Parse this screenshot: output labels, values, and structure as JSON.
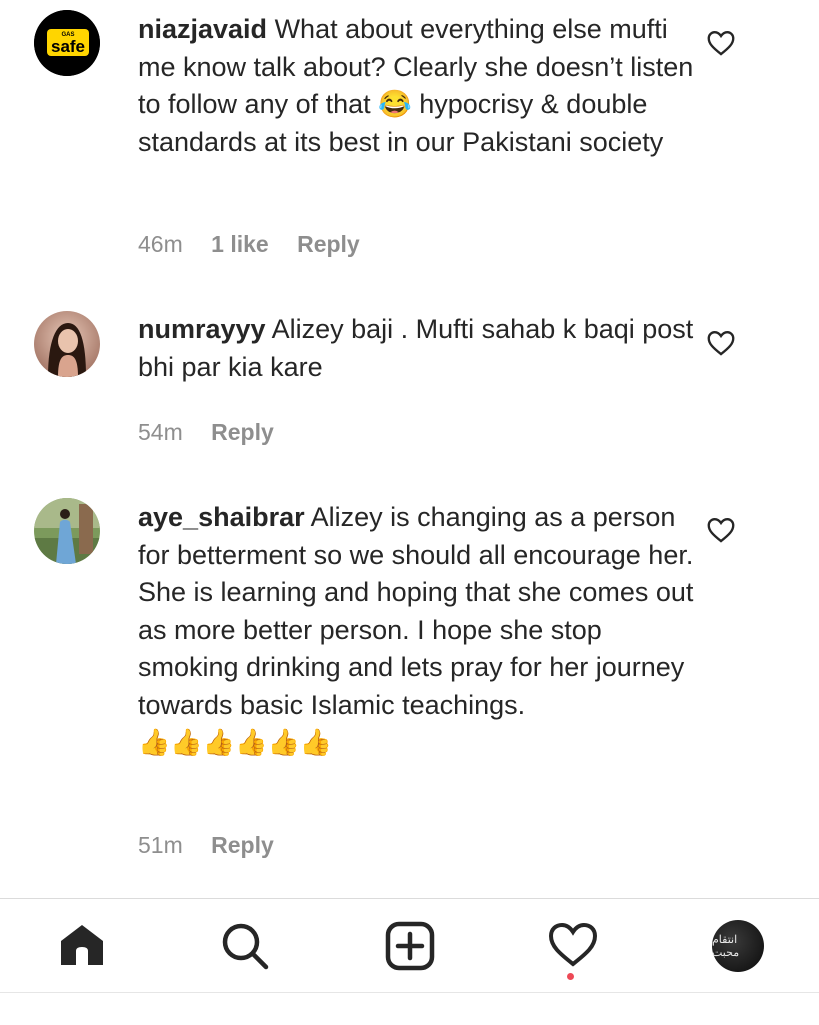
{
  "comments": [
    {
      "username": "niazjavaid",
      "text": "What about everything else mufti me know talk about? Clearly she doesn’t listen to follow any of that 😂 hypocrisy & double standards at its best in our Pakistani society",
      "time": "46m",
      "likes": "1 like",
      "reply": "Reply",
      "avatar_text": "safe",
      "avatar_small_text": "GAS"
    },
    {
      "username": "numrayyy",
      "text": "Alizey baji . Mufti sahab k baqi post bhi par kia kare",
      "time": "54m",
      "reply": "Reply"
    },
    {
      "username": "aye_shaibrar",
      "text": "Alizey is changing as a person for betterment so we should all encourage her. She is learning and hoping that she comes out as more better person. I hope she stop smoking drinking and lets pray for her journey towards basic Islamic teachings.",
      "emojis": "👍👍👍👍👍👍",
      "time": "51m",
      "reply": "Reply"
    }
  ],
  "nav": {
    "items": [
      "home-icon",
      "search-icon",
      "new-post-icon",
      "activity-heart-icon",
      "profile-avatar"
    ],
    "profile_text": "انتقام محبت"
  },
  "colors": {
    "text": "#262626",
    "meta": "#8e8e8e",
    "notification_dot": "#ed4956",
    "avatar1_bg": "#000000",
    "avatar1_badge": "#ffd500"
  }
}
